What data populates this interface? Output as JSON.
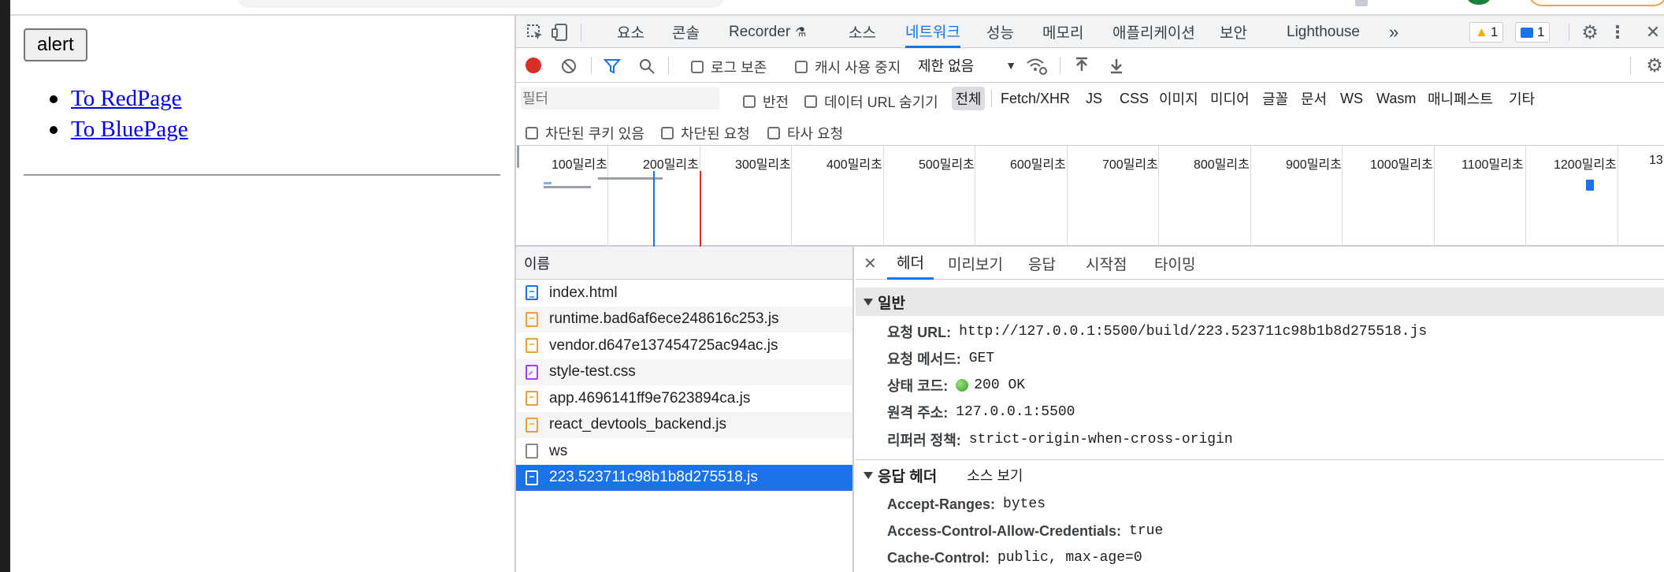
{
  "page": {
    "alert_label": "alert",
    "links": [
      "To RedPage",
      "To BluePage"
    ]
  },
  "devtools": {
    "tabs": [
      "요소",
      "콘솔",
      "Recorder",
      "소스",
      "네트워크",
      "성능",
      "메모리",
      "애플리케이션",
      "보안",
      "Lighthouse"
    ],
    "selected_tab": "네트워크",
    "warning_count": "1",
    "message_count": "1",
    "toolbar": {
      "preserve_log": "로그 보존",
      "disable_cache": "캐시 사용 중지",
      "throttle": "제한 없음"
    },
    "filter": {
      "placeholder": "필터",
      "invert": "반전",
      "hide_data_urls": "데이터 URL 숨기기",
      "types": [
        "전체",
        "Fetch/XHR",
        "JS",
        "CSS",
        "이미지",
        "미디어",
        "글꼴",
        "문서",
        "WS",
        "Wasm",
        "매니페스트",
        "기타"
      ],
      "blocked_cookies": "차단된 쿠키 있음",
      "blocked_requests": "차단된 요청",
      "third_party": "타사 요청"
    },
    "timeline_ticks": [
      "100밀리초",
      "200밀리초",
      "300밀리초",
      "400밀리초",
      "500밀리초",
      "600밀리초",
      "700밀리초",
      "800밀리초",
      "900밀리초",
      "1000밀리초",
      "1100밀리초",
      "1200밀리초",
      "13"
    ],
    "name_header": "이름",
    "requests": [
      {
        "name": "index.html",
        "type": "html"
      },
      {
        "name": "runtime.bad6af6ece248616c253.js",
        "type": "js"
      },
      {
        "name": "vendor.d647e137454725ac94ac.js",
        "type": "js"
      },
      {
        "name": "style-test.css",
        "type": "css"
      },
      {
        "name": "app.4696141ff9e7623894ca.js",
        "type": "js"
      },
      {
        "name": "react_devtools_backend.js",
        "type": "js"
      },
      {
        "name": "ws",
        "type": "ws"
      },
      {
        "name": "223.523711c98b1b8d275518.js",
        "type": "js"
      }
    ],
    "selected_request": "223.523711c98b1b8d275518.js",
    "detail_tabs": [
      "헤더",
      "미리보기",
      "응답",
      "시작점",
      "타이밍"
    ],
    "general": {
      "title": "일반",
      "request_url_label": "요청 URL:",
      "request_url": "http://127.0.0.1:5500/build/223.523711c98b1b8d275518.js",
      "method_label": "요청 메서드:",
      "method": "GET",
      "status_label": "상태 코드:",
      "status": "200 OK",
      "remote_label": "원격 주소:",
      "remote": "127.0.0.1:5500",
      "referrer_label": "리퍼러 정책:",
      "referrer": "strict-origin-when-cross-origin"
    },
    "response_headers": {
      "title": "응답 헤더",
      "view_source": "소스 보기",
      "items": [
        {
          "k": "Accept-Ranges:",
          "v": "bytes"
        },
        {
          "k": "Access-Control-Allow-Credentials:",
          "v": "true"
        },
        {
          "k": "Cache-Control:",
          "v": "public, max-age=0"
        }
      ]
    }
  },
  "colors": {
    "accent": "#1a73e8",
    "record": "#d93025",
    "status_ok": "#34a853"
  }
}
